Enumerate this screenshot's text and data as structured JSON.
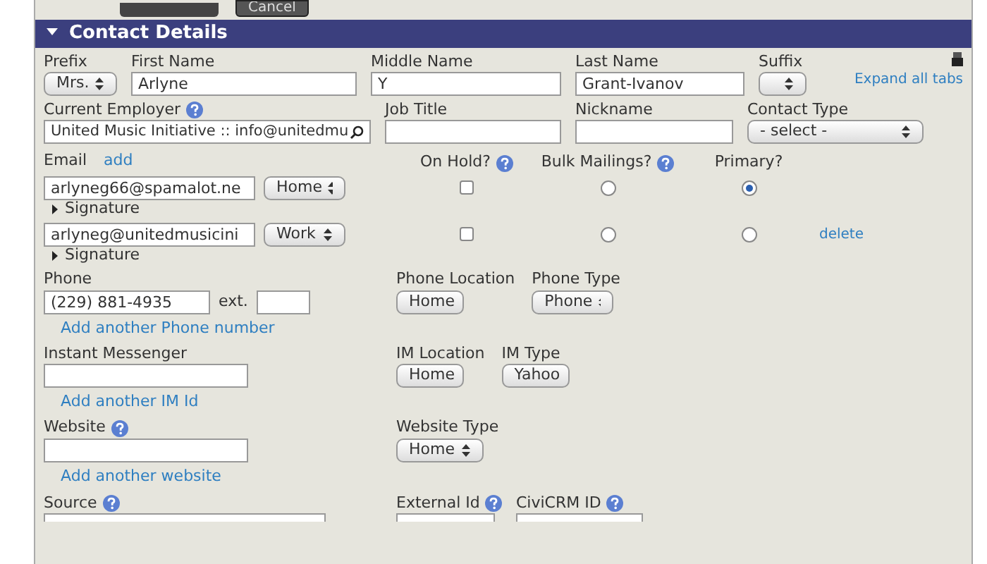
{
  "top_buttons": [
    "Cancel"
  ],
  "section": {
    "title": "Contact Details",
    "expanded": true
  },
  "expand_all": "Expand all tabs",
  "name_fields": [
    {
      "label": "Prefix",
      "kind": "select",
      "value": "Mrs."
    },
    {
      "label": "First Name",
      "kind": "text",
      "value": "Arlyne"
    },
    {
      "label": "Middle Name",
      "kind": "text",
      "value": "Y"
    },
    {
      "label": "Last Name",
      "kind": "text",
      "value": "Grant-Ivanov"
    },
    {
      "label": "Suffix",
      "kind": "select"
    }
  ],
  "detail_fields": [
    {
      "label": "Current Employer",
      "help": true,
      "kind": "search",
      "value": "United Music Initiative :: info@unitedmu"
    },
    {
      "label": "Job Title",
      "help": false,
      "kind": "text"
    },
    {
      "label": "Nickname",
      "help": false,
      "kind": "text"
    },
    {
      "label": "Contact Type",
      "help": false,
      "kind": "select",
      "value": "- select -"
    }
  ],
  "email": {
    "label": "Email",
    "add_link": "add",
    "columns": [
      {
        "label": "On Hold?",
        "help": true
      },
      {
        "label": "Bulk Mailings?",
        "help": true
      },
      {
        "label": "Primary?",
        "help": false
      }
    ],
    "rows": [
      {
        "value": "arlyneg66@spamalot.ne",
        "location": "Home",
        "on_hold": false,
        "bulk": false,
        "primary": true,
        "signature": "Signature"
      },
      {
        "value": "arlyneg@unitedmusicini",
        "location": "Work",
        "on_hold": false,
        "bulk": false,
        "primary": false,
        "signature": "Signature",
        "delete": "delete"
      }
    ]
  },
  "phone": {
    "label": "Phone",
    "value": "(229) 881-4935",
    "ext_label": "ext.",
    "location_label": "Phone Location",
    "location": "Home",
    "type_label": "Phone Type",
    "type": "Phone",
    "add_link": "Add another Phone number"
  },
  "im": {
    "label": "Instant Messenger",
    "location_label": "IM Location",
    "location": "Home",
    "type_label": "IM Type",
    "type": "Yahoo",
    "add_link": "Add another IM Id"
  },
  "website": {
    "label": "Website",
    "help": true,
    "type_label": "Website Type",
    "type": "Home",
    "add_link": "Add another website"
  },
  "bottom_fields": [
    {
      "label": "Source",
      "help": true
    },
    {
      "label": "External Id",
      "help": true
    },
    {
      "label": "CiviCRM ID",
      "help": true
    }
  ]
}
